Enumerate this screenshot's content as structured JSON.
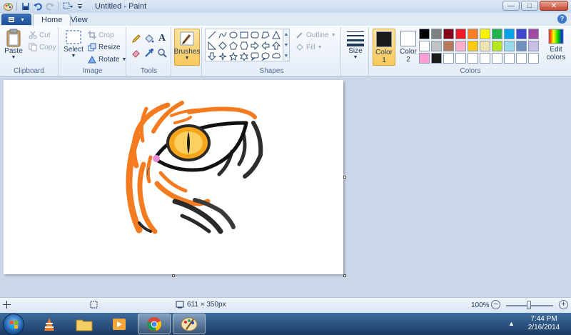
{
  "window": {
    "title": "Untitled - Paint",
    "controls": {
      "minimize": "—",
      "maximize": "□",
      "close": "✕"
    }
  },
  "tabs": {
    "file_label": "▾",
    "home": "Home",
    "view": "View",
    "help": "?"
  },
  "ribbon": {
    "clipboard": {
      "group": "Clipboard",
      "paste": "Paste",
      "cut": "Cut",
      "copy": "Copy"
    },
    "image": {
      "group": "Image",
      "select": "Select",
      "crop": "Crop",
      "resize": "Resize",
      "rotate": "Rotate"
    },
    "tools": {
      "group": "Tools"
    },
    "brushes": {
      "label": "Brushes"
    },
    "shapes": {
      "group": "Shapes",
      "outline": "Outline",
      "fill": "Fill"
    },
    "size": {
      "label": "Size"
    },
    "colors": {
      "group": "Colors",
      "color1": "Color 1",
      "color2": "Color 2",
      "edit": "Edit colors",
      "color1_value": "#1a1a1a",
      "color2_value": "#ffffff",
      "palette_row1": [
        "#000000",
        "#7f7f7f",
        "#880015",
        "#ed1c24",
        "#ff7f27",
        "#fff200",
        "#22b14c",
        "#00a2e8",
        "#3f48cc",
        "#a349a4"
      ],
      "palette_row2": [
        "#ffffff",
        "#c3c3c3",
        "#b97a57",
        "#ffaec9",
        "#ffc90e",
        "#efe4b0",
        "#b5e61d",
        "#99d9ea",
        "#7092be",
        "#c8bfe7"
      ],
      "palette_row3": [
        "#ff9fd4",
        "#1a1a1a",
        "#ffffff",
        "#ffffff",
        "#ffffff",
        "#ffffff",
        "#ffffff",
        "#ffffff",
        "#ffffff",
        "#ffffff"
      ]
    }
  },
  "status": {
    "dimensions": "611 × 350px",
    "zoom": "100%",
    "zoom_out": "−",
    "zoom_in": "+"
  },
  "taskbar": {
    "apps": [
      "windows-explorer",
      "vlc",
      "file-explorer",
      "media-player",
      "chrome",
      "paint"
    ],
    "time": "7:44 PM",
    "date": "2/16/2014"
  }
}
